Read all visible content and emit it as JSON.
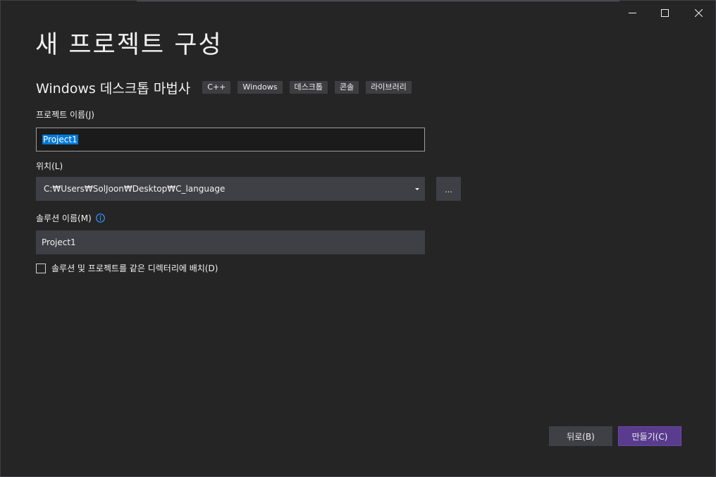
{
  "window": {
    "title": "새 프로젝트 구성",
    "subtitle": "Windows 데스크톱 마법사",
    "tags": [
      "C++",
      "Windows",
      "데스크톱",
      "콘솔",
      "라이브러리"
    ]
  },
  "form": {
    "project_name": {
      "label": "프로젝트 이름(J)",
      "value": "Project1"
    },
    "location": {
      "label": "위치(L)",
      "value": "C:₩Users₩SolJoon₩Desktop₩C_language",
      "browse_label": "..."
    },
    "solution_name": {
      "label": "솔루션 이름(M)",
      "value": "Project1"
    },
    "same_directory": {
      "label": "솔루션 및 프로젝트를 같은 디렉터리에 배치(D)",
      "checked": false
    }
  },
  "footer": {
    "back_label": "뒤로(B)",
    "create_label": "만들기(C)"
  },
  "colors": {
    "background": "#252526",
    "field": "#3f3f46",
    "accent": "#5a3c8e",
    "selection": "#0078d7",
    "info": "#3794ff"
  }
}
